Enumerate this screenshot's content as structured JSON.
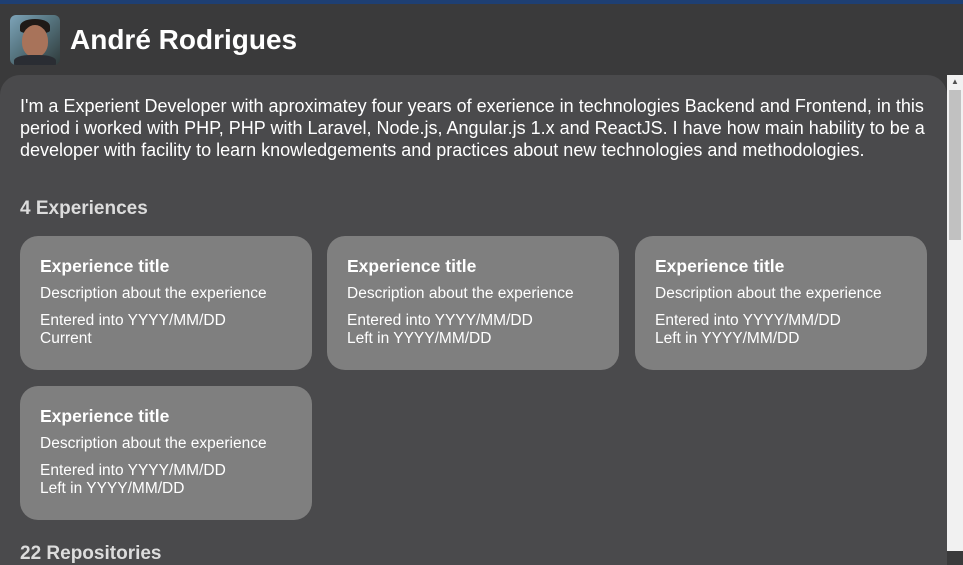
{
  "profile": {
    "name": "André Rodrigues",
    "avatar_alt": "profile photo"
  },
  "about": {
    "text": "I'm a Experient Developer with aproximatey four years of exerience in technologies Backend and Frontend, in this period i worked with PHP, PHP with Laravel, Node.js, Angular.js 1.x and ReactJS. I have how main hability to be a developer with facility to learn knowledgements and practices about new technologies and methodologies."
  },
  "experiences": {
    "heading": "4 Experiences",
    "items": [
      {
        "title": "Experience title",
        "description": "Description about the experience",
        "entered": "Entered into YYYY/MM/DD",
        "left": "Current"
      },
      {
        "title": "Experience title",
        "description": "Description about the experience",
        "entered": "Entered into YYYY/MM/DD",
        "left": "Left in YYYY/MM/DD"
      },
      {
        "title": "Experience title",
        "description": "Description about the experience",
        "entered": "Entered into YYYY/MM/DD",
        "left": "Left in YYYY/MM/DD"
      },
      {
        "title": "Experience title",
        "description": "Description about the experience",
        "entered": "Entered into YYYY/MM/DD",
        "left": "Left in YYYY/MM/DD"
      }
    ]
  },
  "next_section": {
    "heading": "22 Repositories"
  },
  "colors": {
    "accent": "#1e3f73",
    "header_bg": "#3a3a3b",
    "panel_bg": "#4a4a4c",
    "card_bg": "#7f7f7f"
  },
  "icons": {
    "scroll_up": "scroll-up-arrow-icon"
  }
}
